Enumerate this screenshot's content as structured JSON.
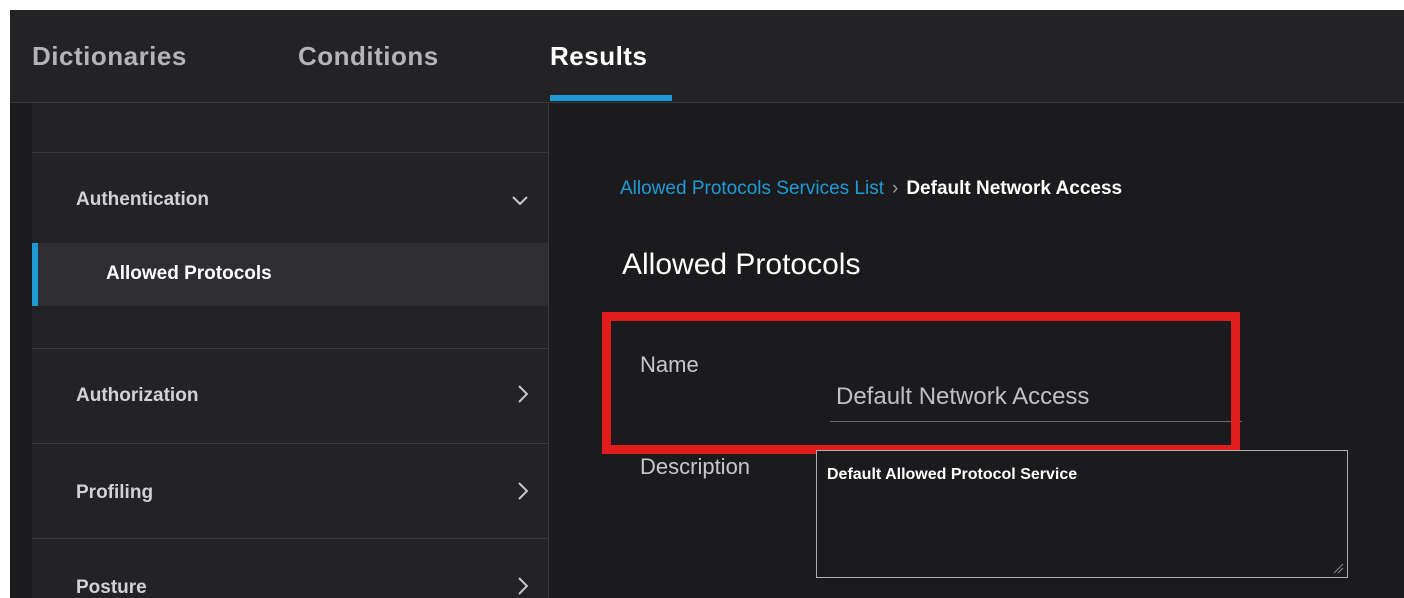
{
  "tabs": [
    {
      "label": "Dictionaries",
      "active": false
    },
    {
      "label": "Conditions",
      "active": false
    },
    {
      "label": "Results",
      "active": true
    }
  ],
  "sidebar": {
    "sections": [
      {
        "label": "Authentication",
        "expanded": true,
        "icon": "chevron-down-icon"
      },
      {
        "label": "Authorization",
        "expanded": false,
        "icon": "chevron-right-icon"
      },
      {
        "label": "Profiling",
        "expanded": false,
        "icon": "chevron-right-icon"
      },
      {
        "label": "Posture",
        "expanded": false,
        "icon": "chevron-right-icon"
      }
    ],
    "active_subitem": "Allowed Protocols"
  },
  "breadcrumb": {
    "link": "Allowed Protocols Services List",
    "current": "Default Network Access"
  },
  "page_title": "Allowed Protocols",
  "form": {
    "name_label": "Name",
    "name_value": "Default Network Access",
    "description_label": "Description",
    "description_value": "Default Allowed Protocol Service"
  },
  "colors": {
    "accent": "#1e9bd7",
    "highlight": "#e01c1c",
    "background": "#1b1b1d",
    "sidebar_bg": "#232326"
  }
}
